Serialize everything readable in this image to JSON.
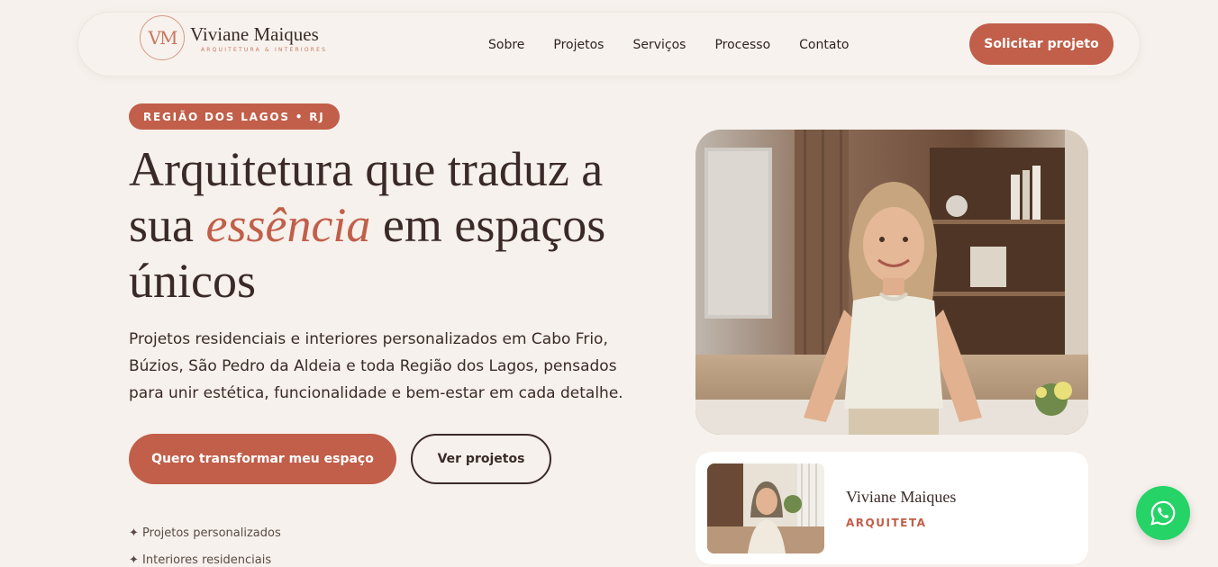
{
  "brand": {
    "monogram": "VM",
    "name": "Viviane Maiques",
    "tagline": "Arquitetura & Interiores",
    "accent_color": "#c15f4a"
  },
  "nav": {
    "items": [
      "Sobre",
      "Projetos",
      "Serviços",
      "Processo",
      "Contato"
    ],
    "cta": "Solicitar projeto"
  },
  "hero": {
    "badge": "REGIÃO DOS LAGOS • RJ",
    "headline_part1": "Arquitetura que traduz a sua ",
    "headline_emphasis": "essência",
    "headline_part2": " em espaços únicos",
    "lead": "Projetos residenciais e interiores personalizados em Cabo Frio, Búzios, São Pedro da Aldeia e toda Região dos Lagos, pensados para unir estética, funcionalidade e bem-estar em cada detalhe.",
    "primary_button": "Quero transformar meu espaço",
    "secondary_button": "Ver projetos",
    "features": [
      "✦ Projetos personalizados",
      "✦ Interiores residenciais"
    ]
  },
  "profile": {
    "name": "Viviane Maiques",
    "role": "ARQUITETA"
  },
  "floating": {
    "icon": "whatsapp-icon",
    "color": "#25d366"
  }
}
